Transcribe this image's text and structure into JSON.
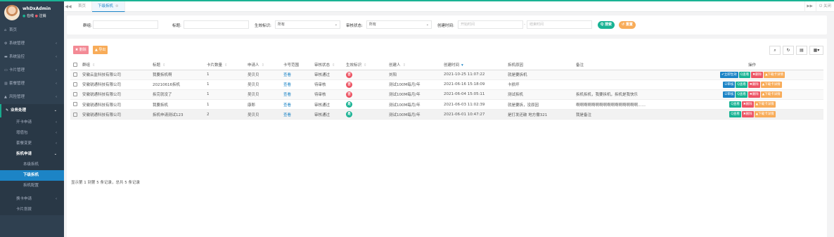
{
  "user": {
    "name": "whDxAdmin",
    "online": "在线",
    "logout": "注销"
  },
  "nav": [
    {
      "icon": "home-icon",
      "label": "首页"
    },
    {
      "icon": "gear-icon",
      "label": "系统管理"
    },
    {
      "icon": "monitor-icon",
      "label": "系统监控"
    },
    {
      "icon": "card-icon",
      "label": "卡片管理"
    },
    {
      "icon": "bank-icon",
      "label": "套餐管理"
    },
    {
      "icon": "warning-icon",
      "label": "风险管理"
    },
    {
      "icon": "pen-icon",
      "label": "业务处理"
    }
  ],
  "subnav": {
    "items_before": [
      "开卡申请",
      "增值包",
      "套餐变更"
    ],
    "open": "拆机申请",
    "open_children": [
      "本级拆机",
      "下级拆机",
      "拆机配置"
    ],
    "current": "下级拆机",
    "items_after": [
      "换卡申请",
      "卡片划拨"
    ]
  },
  "tabs": {
    "prev": "◀◀",
    "home": "首页",
    "active": "下级拆机",
    "next": "▶▶",
    "close": "关闭"
  },
  "filters": {
    "group_label": "群组:",
    "title_label": "标题:",
    "effective_label": "生效标识:",
    "effective_value": "所有",
    "audit_label": "审核状态:",
    "audit_value": "所有",
    "created_label": "创建时间:",
    "start_placeholder": "开始时间",
    "end_placeholder": "结束时间",
    "dash": "-",
    "search_btn": "Q 搜索",
    "reset_btn": "↺ 重置"
  },
  "toolbar": {
    "delete": "✖ 删除",
    "export": "▲ 导出"
  },
  "table": {
    "headers": [
      "群组",
      "标题",
      "卡片数量",
      "申请人",
      "卡号范围",
      "审核状态",
      "生效标识",
      "创建人",
      "创建时间",
      "拆机原因",
      "备注",
      "操作"
    ],
    "rows": [
      {
        "group": "安徽云监科技有限公司",
        "title": "我要拆机啊",
        "count": "1",
        "applicant": "吴贝贝",
        "range": "查看",
        "audit": "审核通过",
        "eff": "否",
        "creator": "刘阳",
        "time": "2021-10-25 11:07:22",
        "reason": "就是要拆机",
        "remark": "",
        "actions": [
          {
            "label": "✔立即生效",
            "color": "c-blue"
          },
          {
            "label": "Q查看",
            "color": "c-green"
          },
          {
            "label": "✖删除",
            "color": "c-red"
          },
          {
            "label": "▲下载卡详情",
            "color": "c-orange"
          }
        ]
      },
      {
        "group": "安徽锐通科技有限公司",
        "title": "20210616拆机",
        "count": "1",
        "applicant": "吴贝贝",
        "range": "查看",
        "audit": "待审核",
        "eff": "否",
        "creator": "测试100M每月/年",
        "time": "2021-06-16 15:18:09",
        "reason": "卡损坏",
        "remark": "",
        "actions": [
          {
            "label": "☑审核",
            "color": "c-blue"
          },
          {
            "label": "Q查看",
            "color": "c-green"
          },
          {
            "label": "✖删除",
            "color": "c-red"
          },
          {
            "label": "▲下载卡详情",
            "color": "c-orange"
          }
        ]
      },
      {
        "group": "安徽锐通科技有限公司",
        "title": "拆完就没了",
        "count": "1",
        "applicant": "吴贝贝",
        "range": "查看",
        "audit": "待审核",
        "eff": "否",
        "creator": "测试100M每月/年",
        "time": "2021-06-04 15:05:11",
        "reason": "测试拆机",
        "remark": "拆机拆机，我要拆机，拆机是我快乐",
        "actions": [
          {
            "label": "☑审核",
            "color": "c-blue"
          },
          {
            "label": "Q查看",
            "color": "c-green"
          },
          {
            "label": "✖删除",
            "color": "c-red"
          },
          {
            "label": "▲下载卡详情",
            "color": "c-orange"
          }
        ]
      },
      {
        "group": "安徽锐通科技有限公司",
        "title": "我要拆机",
        "count": "1",
        "applicant": "康郎",
        "range": "查看",
        "audit": "审核通过",
        "eff": "是",
        "creator": "测试100M每月/年",
        "time": "2021-06-03 11:02:39",
        "reason": "就是要拆，没原因",
        "remark": "啊啊啊啊啊啊啊啊啊啊啊啊啊啊啊啊……",
        "actions": [
          {
            "label": "Q查看",
            "color": "c-green"
          },
          {
            "label": "✖删除",
            "color": "c-red"
          },
          {
            "label": "▲下载卡详情",
            "color": "c-orange"
          }
        ]
      },
      {
        "group": "安徽锐通科技有限公司",
        "title": "拆机申请测试123",
        "count": "2",
        "applicant": "吴贝贝",
        "range": "查看",
        "audit": "审核通过",
        "eff": "是",
        "creator": "测试100M每月/年",
        "time": "2021-06-01 10:47:27",
        "reason": "是打发还破 地方撒321",
        "remark": "我是备注",
        "actions": [
          {
            "label": "Q查看",
            "color": "c-green"
          },
          {
            "label": "✖删除",
            "color": "c-red"
          },
          {
            "label": "▲下载卡详情",
            "color": "c-orange"
          }
        ]
      }
    ]
  },
  "pagination": "显示第 1 到第 5 条记录，总共 5 条记录",
  "colors": {
    "sidebar": "#2f4050",
    "primary": "#1c84c6",
    "green": "#1ab394",
    "red": "#ed5565",
    "orange": "#f8ac59"
  }
}
